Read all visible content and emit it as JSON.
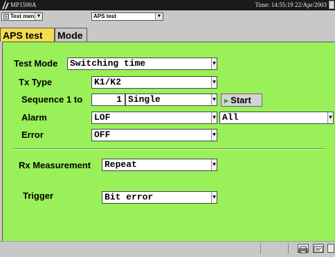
{
  "titlebar": {
    "model": "MP1590A",
    "time": "Time: 14:55:19 22/Apr/2003"
  },
  "menubar": {
    "menu_select": "Test menu",
    "test_select": "APS test"
  },
  "tabs": [
    {
      "label": "APS test",
      "active": true
    },
    {
      "label": "Mode",
      "active": false
    }
  ],
  "form": {
    "test_mode_label": "Test Mode",
    "test_mode_value": "Switching time",
    "tx_type_label": "Tx  Type",
    "tx_type_value": "K1/K2",
    "sequence_label": "Sequence 1 to",
    "sequence_count": "1",
    "sequence_mode": "Single",
    "start_label": "Start",
    "alarm_label": "Alarm",
    "alarm_value": "LOF",
    "alarm_scope": "All",
    "error_label": "Error",
    "error_value": "OFF",
    "rx_label": "Rx  Measurement",
    "rx_value": "Repeat",
    "trigger_label": "Trigger",
    "trigger_value": "Bit error"
  },
  "colors": {
    "panel": "#99f058",
    "active_tab": "#f5dc4e",
    "titlebar": "#1a1a1a"
  },
  "icons": [
    "anritsu-logo-icon",
    "menu-icon",
    "chevron-down-icon",
    "play-icon",
    "printer-icon",
    "screen-icon"
  ]
}
